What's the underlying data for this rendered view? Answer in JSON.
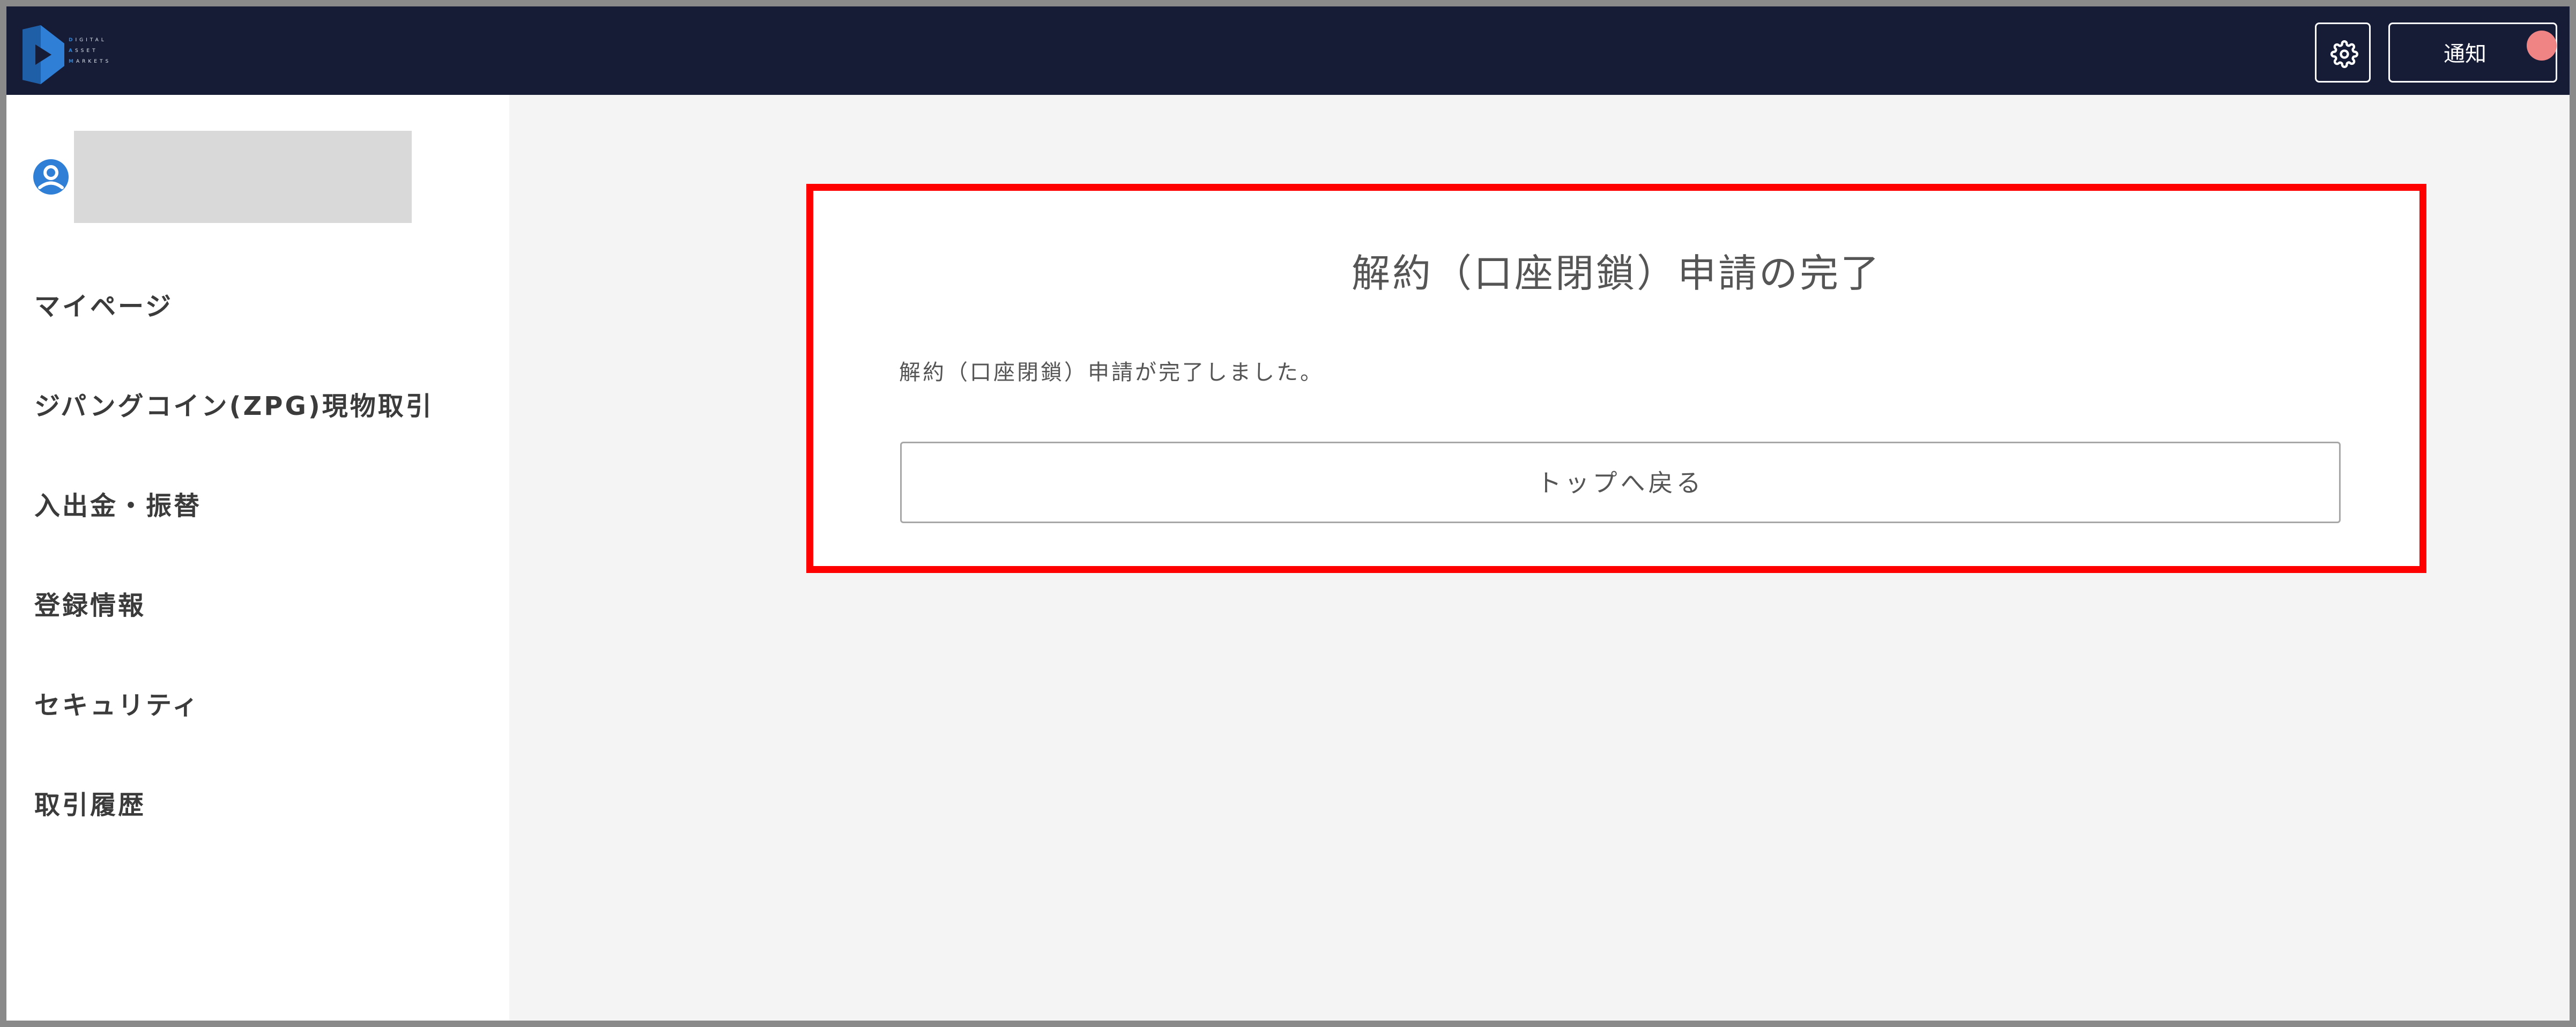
{
  "header": {
    "logo": {
      "icon": "digital-asset-markets-logo",
      "lines": [
        {
          "cap": "D",
          "rest": "IGITAL"
        },
        {
          "cap": "A",
          "rest": "SSET"
        },
        {
          "cap": "M",
          "rest": "ARKETS"
        }
      ],
      "brand_color": "#2f84d8"
    },
    "settings": {
      "icon": "gear-icon"
    },
    "notification": {
      "label": "通知",
      "badge_color": "#f08384"
    },
    "background": "#161c36"
  },
  "sidebar": {
    "user": {
      "icon": "user-avatar-icon",
      "name_redacted": true
    },
    "items": [
      {
        "label": "マイページ"
      },
      {
        "label": "ジパングコイン(ZPG)現物取引"
      },
      {
        "label": "入出金・振替"
      },
      {
        "label": "登録情報"
      },
      {
        "label": "セキュリティ"
      },
      {
        "label": "取引履歴"
      }
    ]
  },
  "main": {
    "title": "解約（口座閉鎖）申請の完了",
    "message": "解約（口座閉鎖）申請が完了しました。",
    "button_label": "トップへ戻る",
    "highlight_color": "#ff0000"
  }
}
